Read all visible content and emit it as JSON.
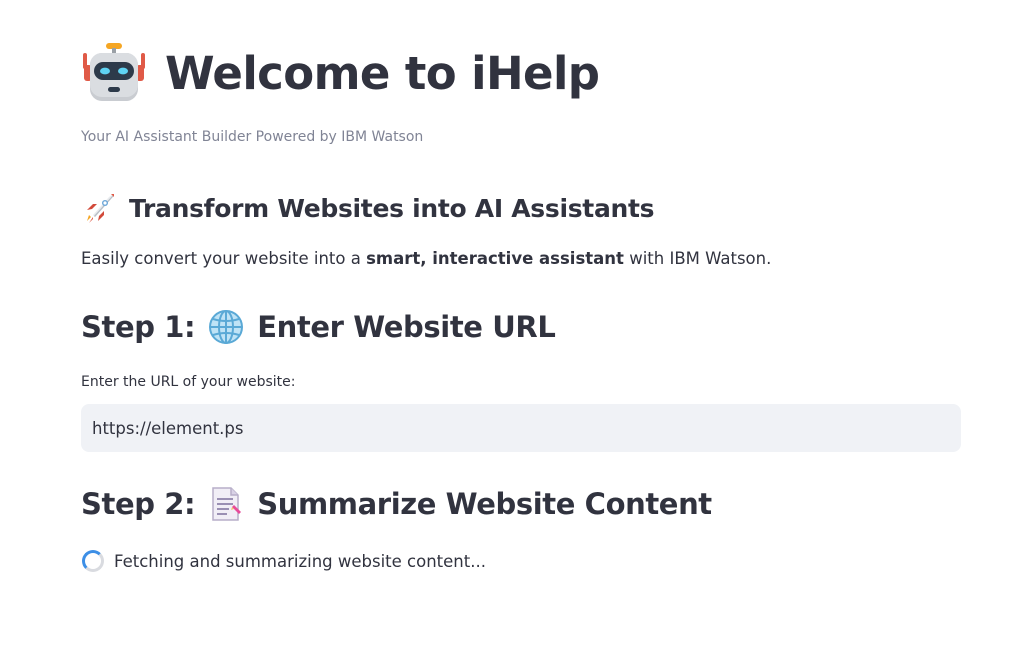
{
  "header": {
    "title_icon": "robot-face-icon",
    "title": "Welcome to iHelp",
    "caption": "Your AI Assistant Builder Powered by IBM Watson"
  },
  "section": {
    "icon": "rocket-icon",
    "heading": "Transform Websites into AI Assistants",
    "intro_before": "Easily convert your website into a ",
    "intro_bold": "smart, interactive assistant",
    "intro_after": " with IBM Watson."
  },
  "step1": {
    "prefix": "Step 1:",
    "icon": "globe-icon",
    "heading": "Enter Website URL",
    "field_label": "Enter the URL of your website:",
    "field_value": "https://element.ps"
  },
  "step2": {
    "prefix": "Step 2:",
    "icon": "document-icon",
    "heading": "Summarize Website Content",
    "status": "Fetching and summarizing website content..."
  },
  "colors": {
    "text": "#31333f",
    "caption": "#808495",
    "input_bg": "#f0f2f6",
    "spinner": "#3d8fe6"
  }
}
